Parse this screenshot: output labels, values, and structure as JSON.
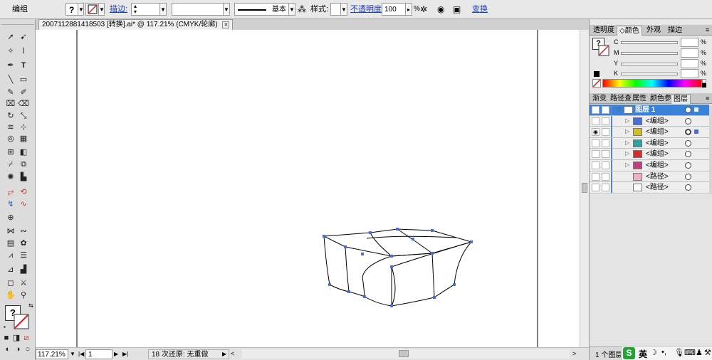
{
  "control_bar": {
    "group_label": "编组",
    "stroke_link": "描边:",
    "stroke_style": "基本",
    "style_label": "样式:",
    "opacity_link": "不透明度:",
    "opacity_value": "100",
    "opacity_unit": "%",
    "transform_link": "变换"
  },
  "document": {
    "tab_title": "2007112881418503 [转换].ai* @ 117.21% (CMYK/轮廓)",
    "close_glyph": "✕"
  },
  "status_bar": {
    "zoom": "117.21%",
    "page": "1",
    "status_text": "18 次还原: 无重做"
  },
  "color_panel": {
    "tabs": [
      "透明度",
      "颜色",
      "外观",
      "描边"
    ],
    "active_tab_index": 1,
    "channels": [
      "C",
      "M",
      "Y",
      "K"
    ]
  },
  "layers_panel": {
    "tabs": [
      "渐变",
      "路径查",
      "属性",
      "颜色参",
      "图层"
    ],
    "active_tab_index": 4,
    "rows": [
      {
        "name": "图层 1",
        "is_top": true,
        "eye_visible": true,
        "has_expander": true
      },
      {
        "name": "<编组>",
        "eye_visible": false,
        "has_expander": true
      },
      {
        "name": "<编组>",
        "eye_visible": true,
        "has_expander": true,
        "selected": true
      },
      {
        "name": "<编组>",
        "eye_visible": false,
        "has_expander": true
      },
      {
        "name": "<编组>",
        "eye_visible": false,
        "has_expander": true
      },
      {
        "name": "<编组>",
        "eye_visible": false,
        "has_expander": true
      },
      {
        "name": "<路径>",
        "eye_visible": false,
        "has_expander": false
      },
      {
        "name": "<路径>",
        "eye_visible": false,
        "has_expander": false
      }
    ],
    "footer_text": "1 个图层"
  },
  "ime": {
    "logo": "S",
    "lang": "英"
  },
  "colors": {
    "selection_blue": "#4a6ed8",
    "layer_highlight": "#3a82d8",
    "link_blue": "#1a3fb8"
  }
}
